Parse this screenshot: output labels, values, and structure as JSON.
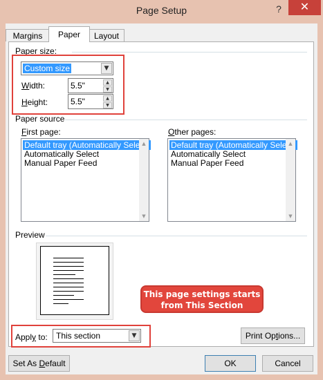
{
  "window": {
    "title": "Page Setup",
    "help": "?",
    "close": "✕"
  },
  "tabs": [
    {
      "label": "Margins"
    },
    {
      "label": "Paper"
    },
    {
      "label": "Layout"
    }
  ],
  "paper_size": {
    "group_label": "Paper size:",
    "size_value": "Custom size",
    "width_label": "Width:",
    "width_value": "5.5\"",
    "height_label": "Height:",
    "height_value": "5.5\""
  },
  "paper_source": {
    "group_label": "Paper source",
    "first_page_label": "First page:",
    "other_pages_label": "Other pages:",
    "first_page_items": [
      "Default tray (Automatically Select)",
      "Automatically Select",
      "Manual Paper Feed"
    ],
    "other_pages_items": [
      "Default tray (Automatically Select)",
      "Automatically Select",
      "Manual Paper Feed"
    ]
  },
  "preview": {
    "label": "Preview"
  },
  "apply": {
    "label": "Apply to:",
    "value": "This section"
  },
  "annotation": {
    "text": "This page settings starts from This Section"
  },
  "buttons": {
    "print_options": "Print Options...",
    "set_as_default": "Set As Default",
    "ok": "OK",
    "cancel": "Cancel"
  },
  "colors": {
    "highlight": "#e0413a",
    "selection": "#3399ff",
    "close": "#c7413a"
  }
}
